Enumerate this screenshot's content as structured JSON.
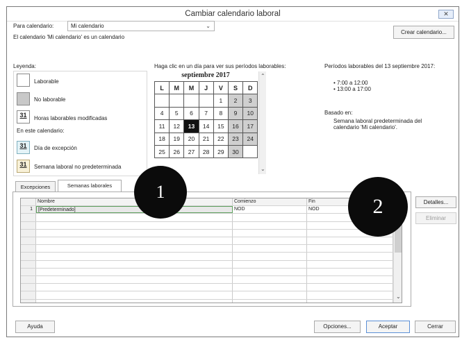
{
  "window": {
    "title": "Cambiar calendario laboral",
    "close_glyph": "✕"
  },
  "calendar_select": {
    "label": "Para calendario:",
    "value": "Mi calendario",
    "chevron": "⌄"
  },
  "info_text": "El calendario 'Mi calendario' es un calendario",
  "create_button": "Crear calendario...",
  "legend": {
    "title": "Leyenda:",
    "items": [
      {
        "label": "Laborable",
        "swatch": ""
      },
      {
        "label": "No laborable",
        "swatch": ""
      },
      {
        "label": "Horas laborables modificadas",
        "swatch": "31"
      }
    ],
    "section": "En este calendario:",
    "items2": [
      {
        "label": "Día de excepción",
        "swatch": "31"
      },
      {
        "label": "Semana laboral no predeterminada",
        "swatch": "31"
      }
    ]
  },
  "calendar": {
    "prompt": "Haga clic en un día para ver sus períodos laborables:",
    "month": "septiembre 2017",
    "weekdays": [
      "L",
      "M",
      "M",
      "J",
      "V",
      "S",
      "D"
    ],
    "weeks": [
      [
        "",
        "",
        "",
        "",
        "1",
        "2",
        "3"
      ],
      [
        "4",
        "5",
        "6",
        "7",
        "8",
        "9",
        "10"
      ],
      [
        "11",
        "12",
        "13",
        "14",
        "15",
        "16",
        "17"
      ],
      [
        "18",
        "19",
        "20",
        "21",
        "22",
        "23",
        "24"
      ],
      [
        "25",
        "26",
        "27",
        "28",
        "29",
        "30",
        ""
      ]
    ],
    "selected_day": "13"
  },
  "periods": {
    "title": "Períodos laborables del 13 septiembre 2017:",
    "items": [
      "• 7:00 a 12:00",
      "• 13:00 a 17:00"
    ],
    "based_label": "Basado en:",
    "based_line1": "Semana laboral predeterminada del",
    "based_line2": "calendario 'Mi calendario'."
  },
  "tabs": [
    "Excepciones",
    "Semanas laborales"
  ],
  "table": {
    "columns": [
      "Nombre",
      "Comienzo",
      "Fin"
    ],
    "rows": [
      {
        "num": "1",
        "name": "[Predeterminado]",
        "start": "NOD",
        "end": "NOD"
      }
    ],
    "scroll_arrow": "⌄"
  },
  "side_buttons": {
    "details": "Detalles...",
    "delete": "Eliminar"
  },
  "footer_buttons": {
    "help": "Ayuda",
    "options": "Opciones...",
    "accept": "Aceptar",
    "cancel": "Cerrar"
  },
  "callouts": [
    "1",
    "2"
  ]
}
